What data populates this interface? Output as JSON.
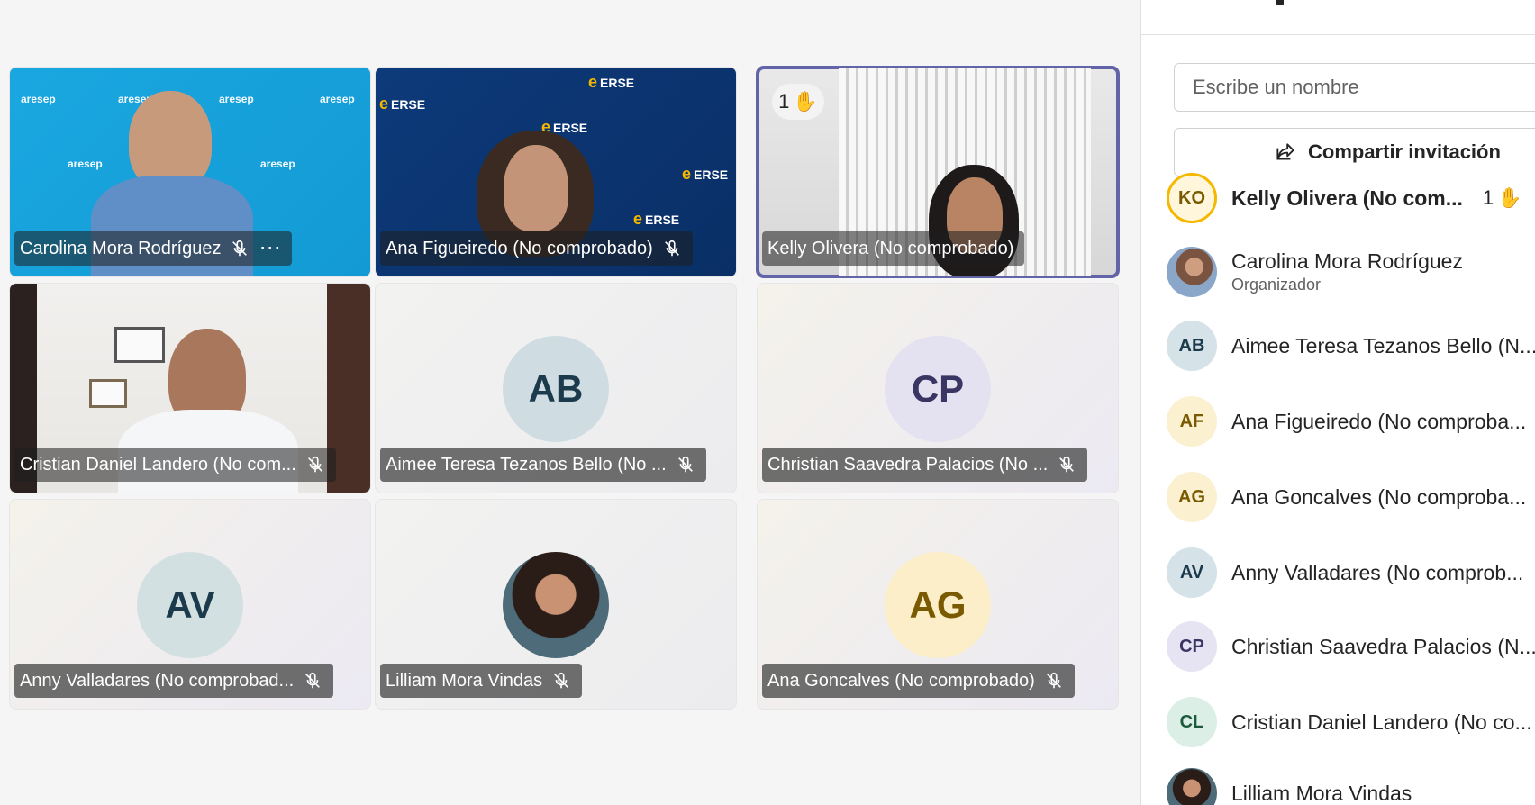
{
  "tiles": [
    {
      "name": "Carolina Mora Rodríguez",
      "type": "video",
      "bg": "blue",
      "muted": true,
      "more": true
    },
    {
      "name": "Ana Figueiredo (No comprobado)",
      "type": "video",
      "bg": "navy",
      "muted": true
    },
    {
      "name": "Kelly Olivera (No comprobado)",
      "type": "video",
      "bg": "window",
      "active": true,
      "hand_count": "1"
    },
    {
      "name": "Cristian Daniel Landero (No com...",
      "type": "video",
      "bg": "office",
      "muted": true
    },
    {
      "name": "Aimee Teresa Tezanos Bello (No ...",
      "type": "avatar",
      "initials": "AB",
      "avatar_color": "#cfdde3",
      "text_color": "#1b3a4b",
      "muted": true
    },
    {
      "name": "Christian Saavedra Palacios (No ...",
      "type": "avatar",
      "initials": "CP",
      "avatar_color": "#e4e1f1",
      "text_color": "#3a3663",
      "muted": true
    },
    {
      "name": "Anny Valladares (No comprobad...",
      "type": "avatar",
      "initials": "AV",
      "avatar_color": "#d3e0e2",
      "text_color": "#1b3a4b",
      "muted": true
    },
    {
      "name": "Lilliam Mora Vindas",
      "type": "photo",
      "muted": true
    },
    {
      "name": "Ana Goncalves (No comprobado)",
      "type": "avatar",
      "initials": "AG",
      "avatar_color": "#fbeec8",
      "text_color": "#7a5a00",
      "muted": true
    }
  ],
  "ersemarks": [
    "ERSE",
    "ERSE",
    "ERSE",
    "ERSE",
    "ERSE"
  ],
  "logo_text": "aresep",
  "panel": {
    "search_placeholder": "Escribe un nombre",
    "share_label": "Compartir invitación",
    "participants": [
      {
        "initials": "KO",
        "name": "Kelly Olivera (No com...",
        "bold": true,
        "ring": true,
        "hand": "1",
        "color": "#fff6dc",
        "tcolor": "#7a5a00"
      },
      {
        "initials": "",
        "name": "Carolina Mora Rodríguez",
        "role": "Organizador",
        "photo": true
      },
      {
        "initials": "AB",
        "name": "Aimee Teresa Tezanos Bello (N...",
        "color": "#d5e2e8",
        "tcolor": "#1b3a4b"
      },
      {
        "initials": "AF",
        "name": "Ana Figueiredo (No comproba...",
        "color": "#fbf0d0",
        "tcolor": "#7a5a00"
      },
      {
        "initials": "AG",
        "name": "Ana Goncalves (No comproba...",
        "color": "#fbf0d0",
        "tcolor": "#7a5a00"
      },
      {
        "initials": "AV",
        "name": "Anny Valladares (No comprob...",
        "color": "#d5e2e8",
        "tcolor": "#1b3a4b"
      },
      {
        "initials": "CP",
        "name": "Christian Saavedra Palacios (N...",
        "color": "#e6e3f3",
        "tcolor": "#3a3663"
      },
      {
        "initials": "CL",
        "name": "Cristian Daniel Landero (No co...",
        "color": "#dcefe6",
        "tcolor": "#1d5a3d"
      },
      {
        "initials": "",
        "name": "Lilliam Mora Vindas",
        "photo": true
      }
    ]
  }
}
